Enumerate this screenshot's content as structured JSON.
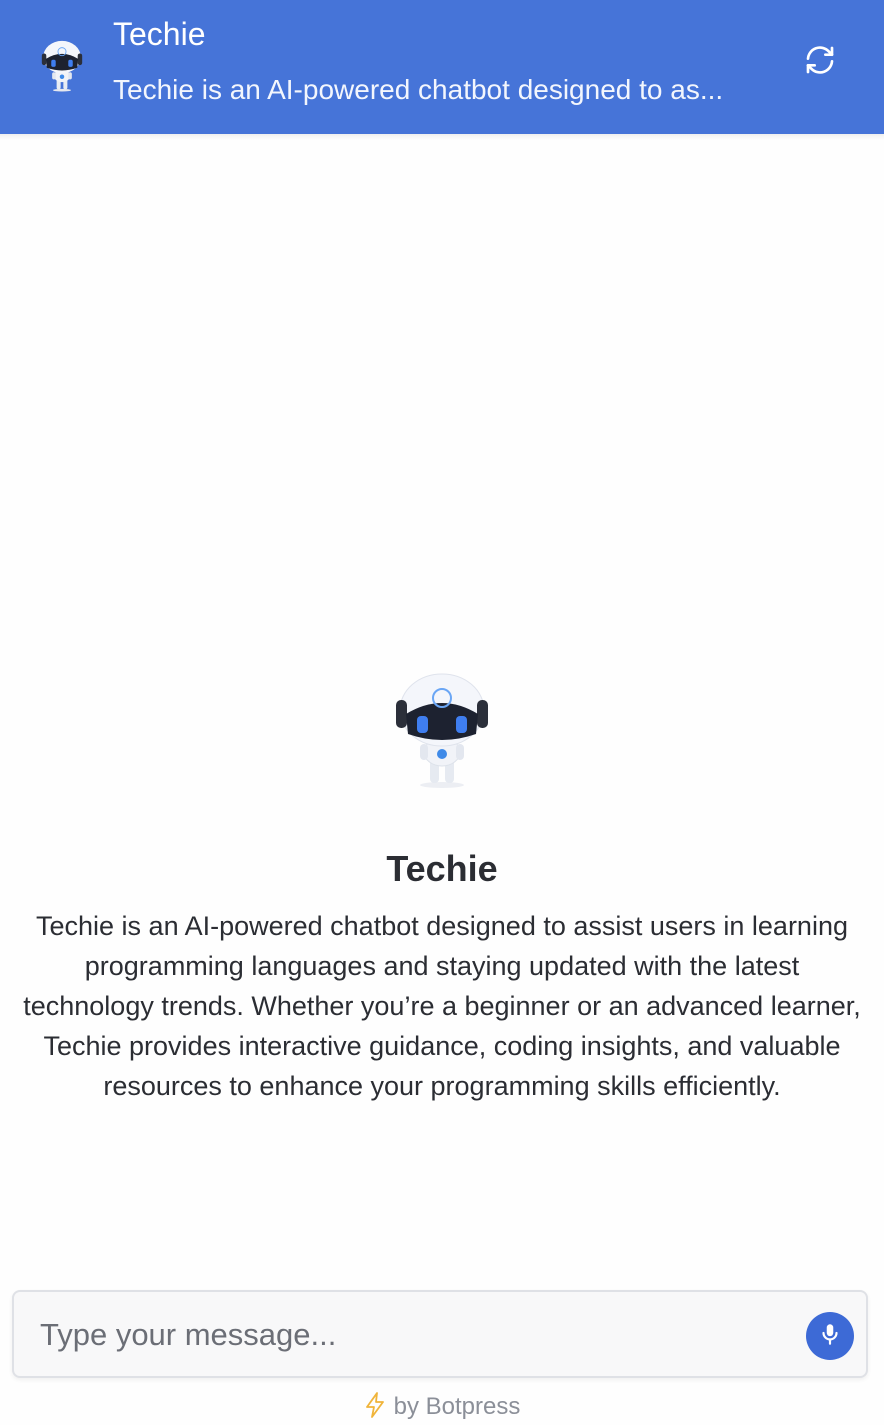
{
  "header": {
    "title": "Techie",
    "description": "Techie is an AI-powered chatbot designed to as...",
    "refresh_icon": "refresh-icon",
    "color": "#4674d8"
  },
  "main": {
    "bot_name": "Techie",
    "bot_description": "Techie is an AI-powered chatbot designed to assist users in learning programming languages and staying updated with the latest technology trends. Whether you’re a beginner or an advanced learner, Techie provides interactive guidance, coding insights, and valuable resources to enhance your programming skills efficiently.",
    "avatar_icon": "robot-avatar-icon"
  },
  "composer": {
    "placeholder": "Type your message...",
    "value": "",
    "mic_icon": "microphone-icon",
    "mic_color": "#3d6ad6"
  },
  "footer": {
    "text": "by Botpress",
    "icon": "lightning-bolt-icon",
    "icon_color": "#f0b43a"
  }
}
